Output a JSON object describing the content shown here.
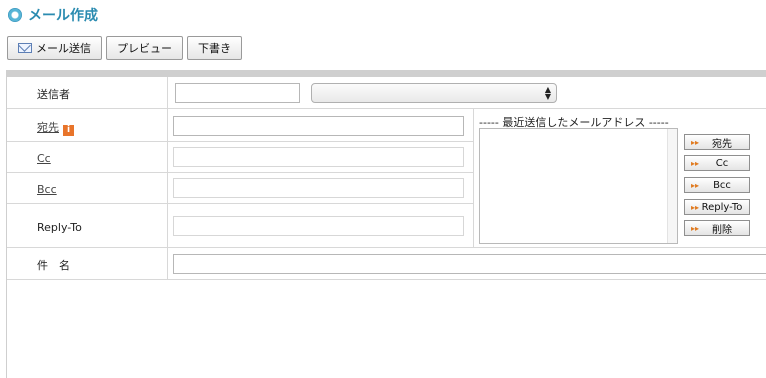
{
  "page": {
    "title": "メール作成"
  },
  "toolbar": {
    "send_label": "メール送信",
    "preview_label": "プレビュー",
    "draft_label": "下書き"
  },
  "form": {
    "sender_label": "送信者",
    "sender_value": "",
    "sender_select_value": "",
    "to_label": "宛先",
    "to_value": "",
    "cc_label": "Cc",
    "cc_value": "",
    "bcc_label": "Bcc",
    "bcc_value": "",
    "replyto_label": "Reply-To",
    "replyto_value": "",
    "subject_label": "件　名",
    "subject_value": ""
  },
  "recent": {
    "title": "----- 最近送信したメールアドレス -----",
    "items": [],
    "buttons": {
      "to": "宛先",
      "cc": "Cc",
      "bcc": "Bcc",
      "replyto": "Reply-To",
      "delete": "削除"
    }
  },
  "icons": {
    "title": "circle-bullet-icon",
    "send": "mail-icon",
    "info": "info-icon",
    "button_arrow": "orange-arrow-icon"
  },
  "colors": {
    "title": "#2a8bb0",
    "info_icon": "#e8742a",
    "arrow": "#e07a1f"
  }
}
